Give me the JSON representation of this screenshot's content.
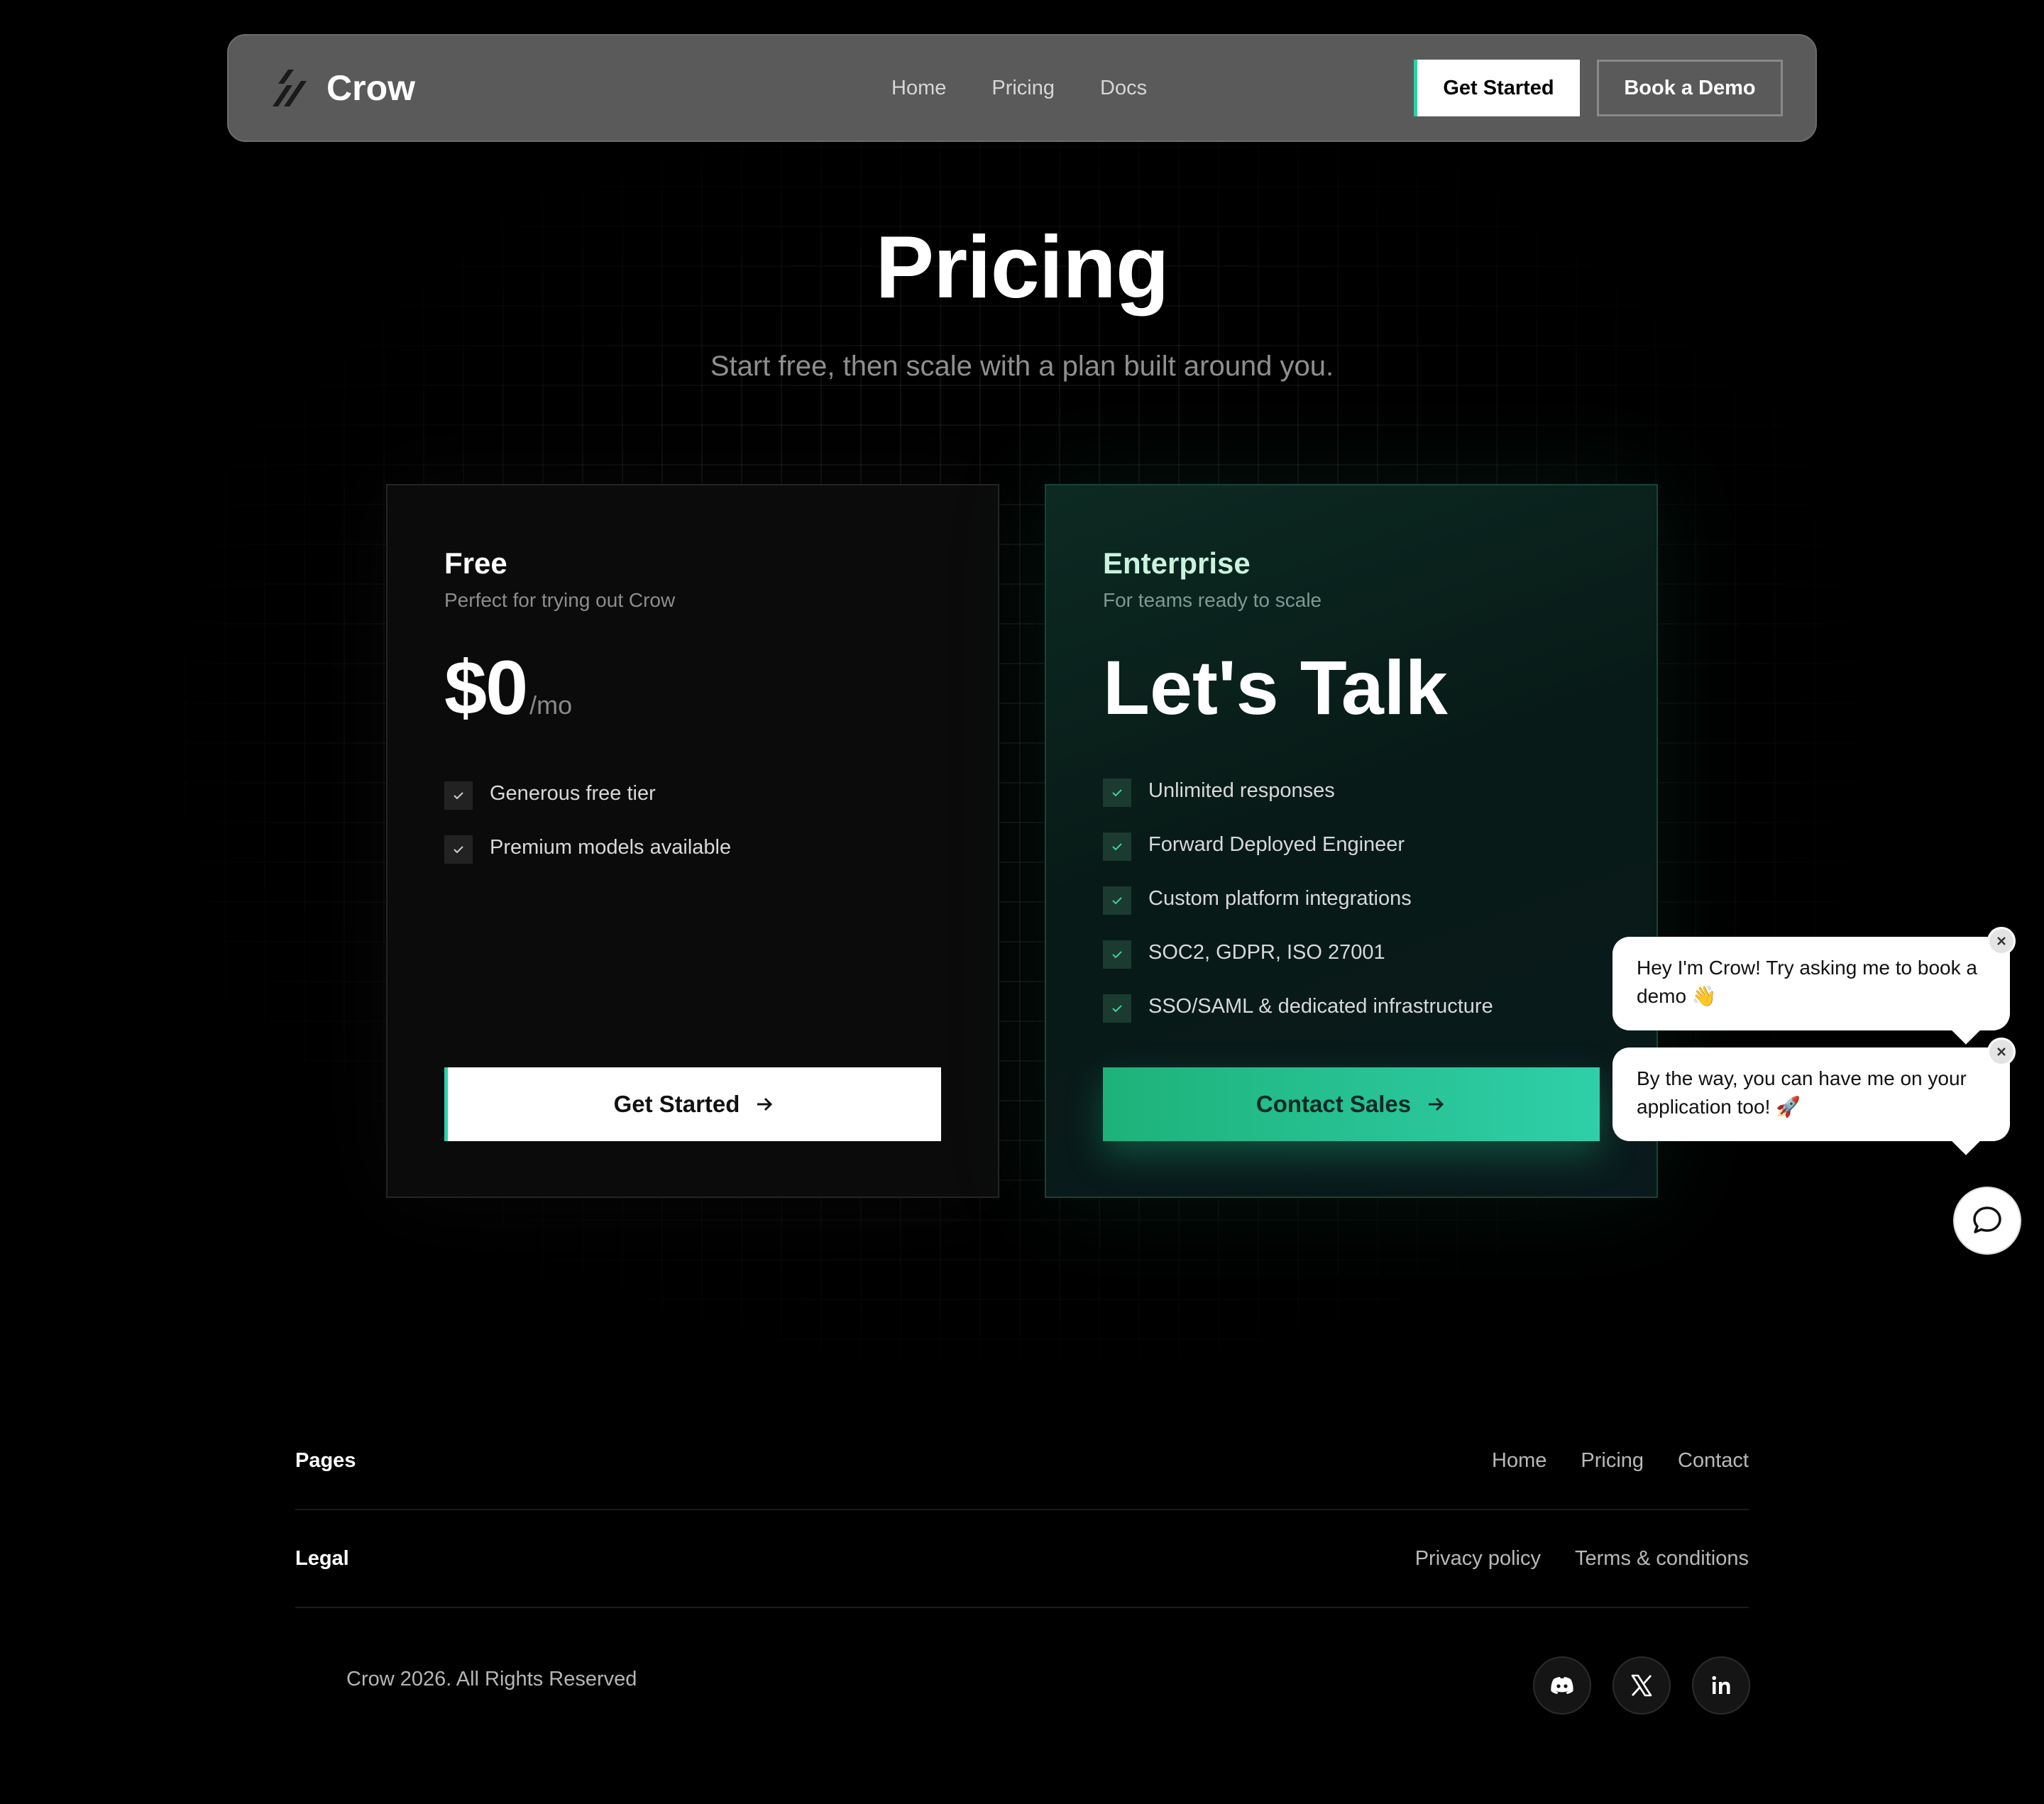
{
  "nav": {
    "brand": "Crow",
    "links": [
      "Home",
      "Pricing",
      "Docs"
    ],
    "get_started": "Get Started",
    "book_demo": "Book a Demo"
  },
  "hero": {
    "title": "Pricing",
    "subtitle": "Start free, then scale with a plan built around you."
  },
  "plans": [
    {
      "name": "Free",
      "description": "Perfect for trying out Crow",
      "price": "$0",
      "unit": "/mo",
      "features": [
        "Generous free tier",
        "Premium models available"
      ],
      "cta": "Get Started"
    },
    {
      "name": "Enterprise",
      "description": "For teams ready to scale",
      "price": "Let's Talk",
      "features": [
        "Unlimited responses",
        "Forward Deployed Engineer",
        "Custom platform integrations",
        "SOC2, GDPR, ISO 27001",
        "SSO/SAML & dedicated infrastructure"
      ],
      "cta": "Contact Sales"
    }
  ],
  "chat": {
    "bubble1": "Hey I'm Crow! Try asking me to book a demo 👋",
    "bubble2": "By the way, you can have me on your application too! 🚀"
  },
  "footer": {
    "pages_heading": "Pages",
    "pages_links": [
      "Home",
      "Pricing",
      "Contact"
    ],
    "legal_heading": "Legal",
    "legal_links": [
      "Privacy policy",
      "Terms & conditions"
    ],
    "copyright": "Crow 2026. All Rights Reserved",
    "socials": [
      "discord-icon",
      "x-icon",
      "linkedin-icon"
    ]
  },
  "colors": {
    "accent": "#2ad3a6",
    "enterprise_button_start": "#1eb27a",
    "enterprise_button_end": "#2fcfa9",
    "navbar": "#5a5a5a"
  }
}
